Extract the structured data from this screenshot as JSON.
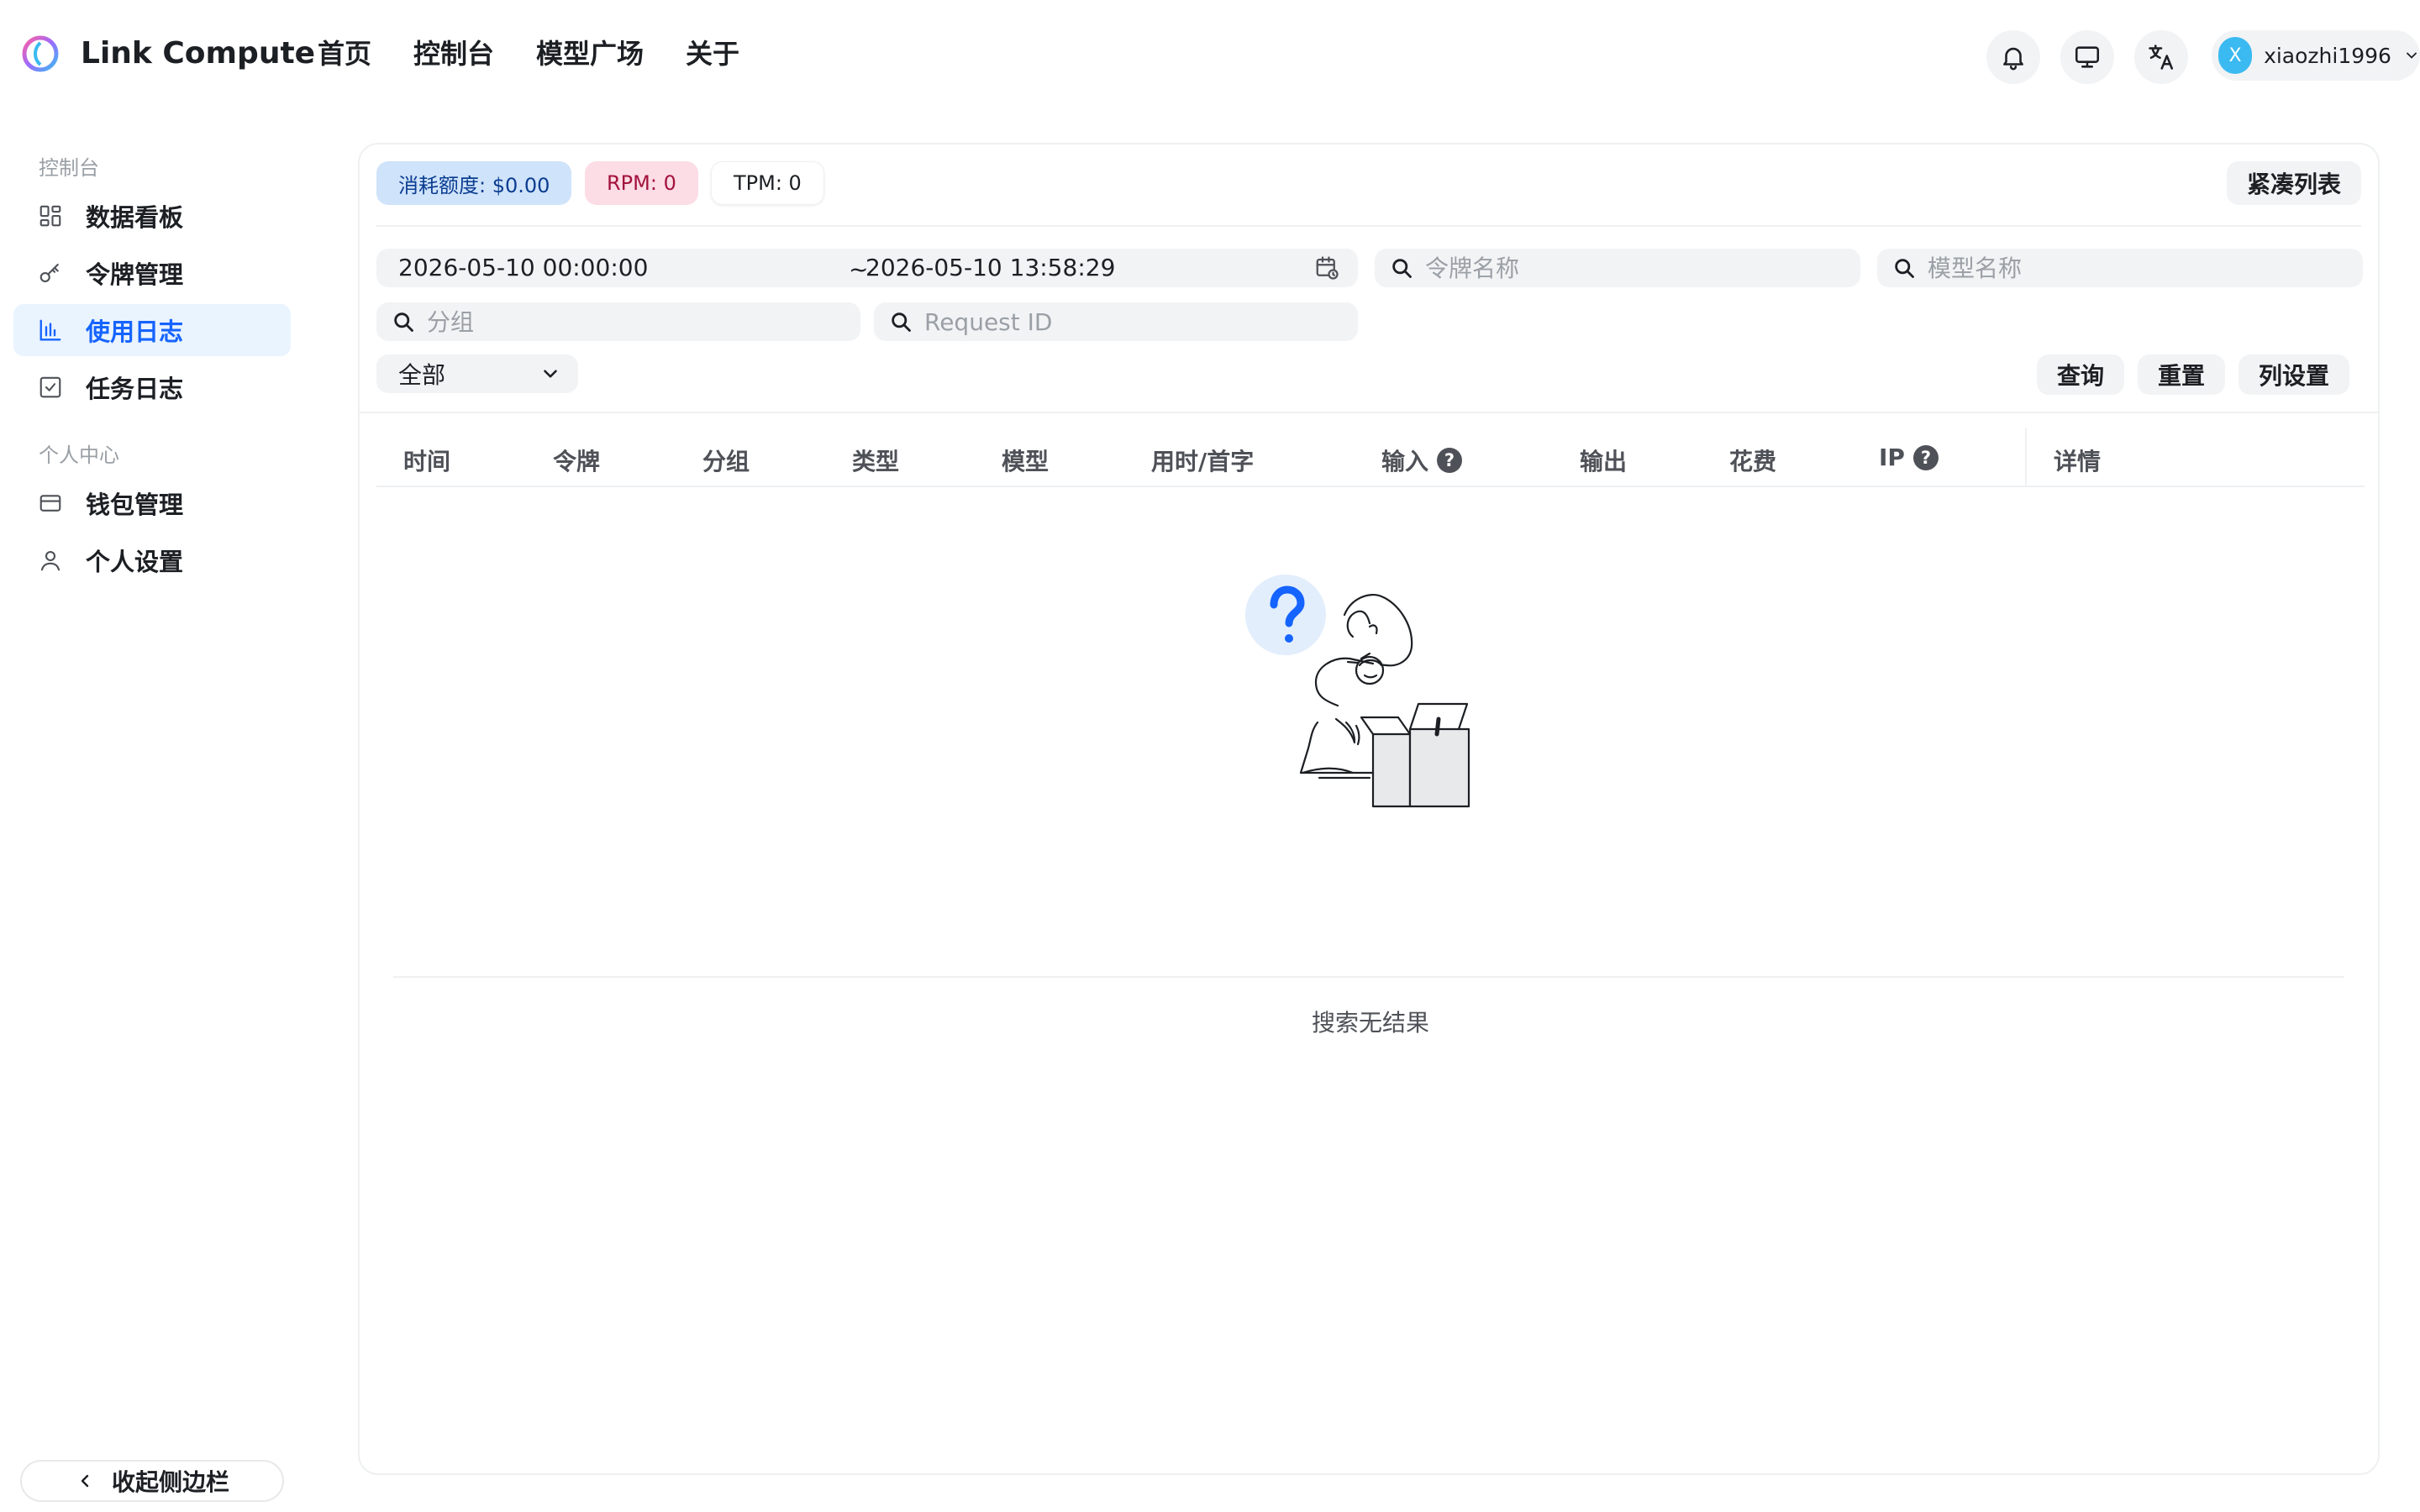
{
  "header": {
    "brand": "Link Compute",
    "nav": [
      "首页",
      "控制台",
      "模型广场",
      "关于"
    ],
    "user": {
      "initial": "X",
      "name": "xiaozhi1996"
    }
  },
  "sidebar": {
    "section_console": "控制台",
    "items_console": [
      {
        "label": "数据看板",
        "icon": "dashboard-icon"
      },
      {
        "label": "令牌管理",
        "icon": "key-icon"
      },
      {
        "label": "使用日志",
        "icon": "bar-chart-icon",
        "active": true
      },
      {
        "label": "任务日志",
        "icon": "task-check-icon"
      }
    ],
    "section_personal": "个人中心",
    "items_personal": [
      {
        "label": "钱包管理",
        "icon": "wallet-icon"
      },
      {
        "label": "个人设置",
        "icon": "user-icon"
      }
    ],
    "collapse_label": "收起侧边栏"
  },
  "stats": {
    "quota": "消耗额度: $0.00",
    "rpm": "RPM: 0",
    "tpm": "TPM: 0"
  },
  "compact_label": "紧凑列表",
  "filters": {
    "date_start": "2026-05-10 00:00:00",
    "date_sep": "~",
    "date_end": "2026-05-10 13:58:29",
    "token_placeholder": "令牌名称",
    "model_placeholder": "模型名称",
    "group_placeholder": "分组",
    "request_placeholder": "Request ID",
    "type_value": "全部"
  },
  "actions": {
    "query": "查询",
    "reset": "重置",
    "columns": "列设置"
  },
  "table": {
    "columns": [
      "时间",
      "令牌",
      "分组",
      "类型",
      "模型",
      "用时/首字",
      "输入",
      "输出",
      "花费",
      "IP",
      "详情"
    ],
    "empty_text": "搜索无结果"
  },
  "colors": {
    "accent": "#1664ff",
    "active_bg": "#eaf4ff",
    "quota_bg": "#cfe3fa",
    "rpm_bg": "#fcdce5"
  }
}
